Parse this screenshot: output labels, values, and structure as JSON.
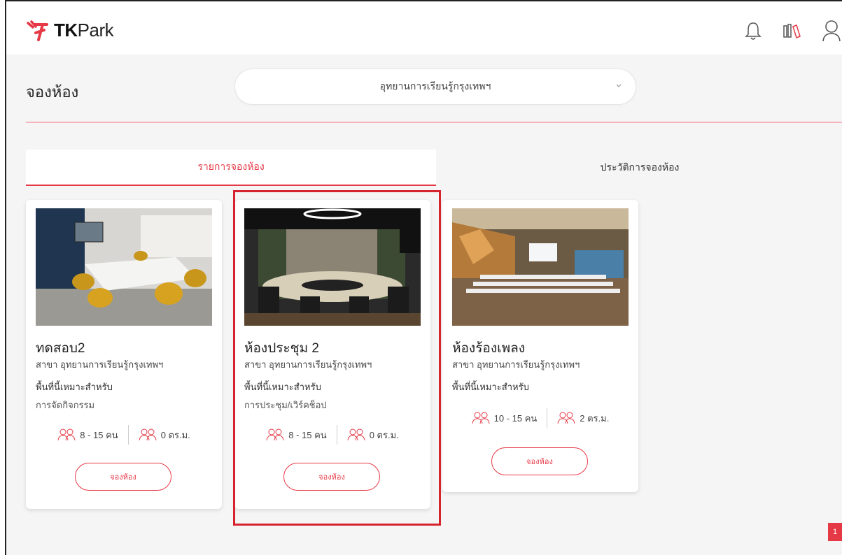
{
  "brand": {
    "logo_text_bold": "TK",
    "logo_text_rest": "Park",
    "accent": "#e63946"
  },
  "header_icons": [
    "bell-icon",
    "books-icon",
    "user-icon"
  ],
  "page": {
    "title": "จองห้อง",
    "branch_select": {
      "value": "อุทยานการเรียนรู้กรุงเทพฯ"
    }
  },
  "tabs": [
    {
      "label": "รายการจองห้อง",
      "active": true
    },
    {
      "label": "ประวัติการจองห้อง",
      "active": false
    }
  ],
  "rooms": [
    {
      "name": "ทดสอบ2",
      "branch": "สาขา อุทยานการเรียนรู้กรุงเทพฯ",
      "suitable_label": "พื้นที่นี้เหมาะสำหรับ",
      "suitable_for": "การจัดกิจกรรม",
      "capacity": "8 - 15 คน",
      "area": "0 ตร.ม.",
      "button": "จองห้อง"
    },
    {
      "name": "ห้องประชุม 2",
      "branch": "สาขา อุทยานการเรียนรู้กรุงเทพฯ",
      "suitable_label": "พื้นที่นี้เหมาะสำหรับ",
      "suitable_for": "การประชุม/เวิร์คช็อป",
      "capacity": "8 - 15 คน",
      "area": "0 ตร.ม.",
      "button": "จองห้อง"
    },
    {
      "name": "ห้องร้องเพลง",
      "branch": "สาขา อุทยานการเรียนรู้กรุงเทพฯ",
      "suitable_label": "พื้นที่นี้เหมาะสำหรับ",
      "suitable_for": "",
      "capacity": "10 - 15 คน",
      "area": "2 ตร.ม.",
      "button": "จองห้อง"
    }
  ],
  "pagination": {
    "badge": "1"
  }
}
